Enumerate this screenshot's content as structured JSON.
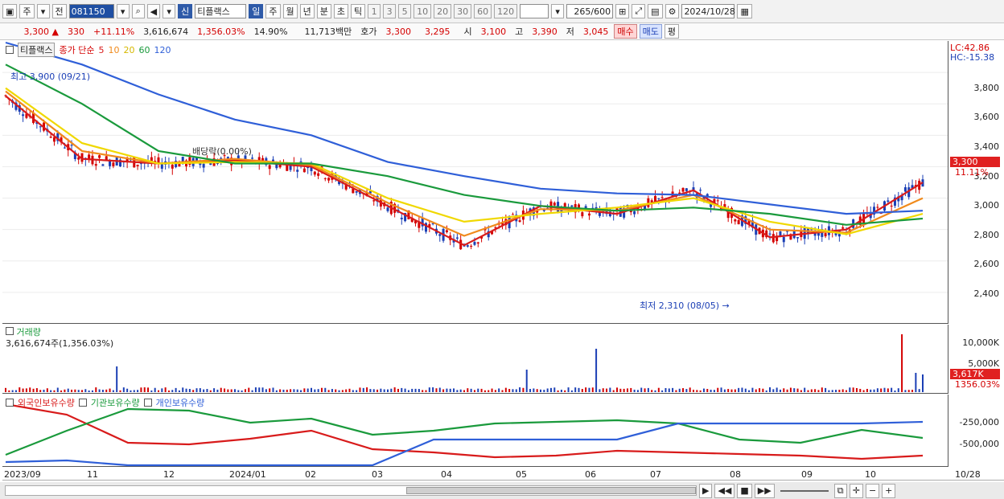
{
  "toolbar": {
    "period_mode": "주",
    "prev": "전",
    "stock_code": "081150",
    "new_badge": "신",
    "stock_name": "티플랙스",
    "periods": [
      "일",
      "주",
      "월",
      "년",
      "분",
      "초",
      "틱"
    ],
    "active_period": "일",
    "minute_options": [
      "1",
      "3",
      "5",
      "10",
      "20",
      "30",
      "60",
      "120"
    ],
    "count_value": "265",
    "count_max": "/600",
    "date": "2024/10/28"
  },
  "quote": {
    "price": "3,300",
    "change_arrow": "▲",
    "change": "330",
    "change_pct": "+11.11%",
    "volume": "3,616,674",
    "volume_ratio": "1,356.03%",
    "turnover": "14.90%",
    "amount": "11,713백만",
    "ask_label": "호가",
    "ask": "3,300",
    "bid": "3,295",
    "open_label": "시",
    "open": "3,100",
    "high_label": "고",
    "high": "3,390",
    "low_label": "저",
    "low": "3,045",
    "buy_label": "매수",
    "sell_label": "매도",
    "flat_label": "평"
  },
  "price_pane": {
    "name": "티플랙스",
    "indicator": "종가 단순",
    "ma_periods": [
      "5",
      "10",
      "20",
      "60",
      "120"
    ],
    "lc": "LC:42.86",
    "hc": "HC:-15.38",
    "high_note": "최고 3,900 (09/21)",
    "low_note": "최저 2,310 (08/05)",
    "dividend_note": "배당락(0.00%)",
    "last_price": "3,300",
    "last_pct": "11.11%",
    "yticks": [
      "3,800",
      "3,600",
      "3,400",
      "3,200",
      "3,000",
      "2,800",
      "2,600",
      "2,400"
    ]
  },
  "volume_pane": {
    "title": "거래량",
    "value": "3,616,674주(1,356.03%)",
    "yticks": [
      "10,000K",
      "5,000K"
    ],
    "last": "3,617K",
    "last_pct": "1356.03%"
  },
  "holding_pane": {
    "series": [
      "외국인보유수량",
      "기관보유수량",
      "개인보유수량"
    ],
    "yticks": [
      "-250,000",
      "-500,000"
    ]
  },
  "xaxis": [
    "2023/09",
    "11",
    "12",
    "2024/01",
    "02",
    "03",
    "04",
    "05",
    "06",
    "07",
    "08",
    "09",
    "10",
    "10/28"
  ],
  "colors": {
    "ma5": "#d81b1b",
    "ma10": "#f08a1c",
    "ma20": "#f0d800",
    "ma60": "#1a9a3c",
    "ma120": "#2f5fd8",
    "up": "#d40000",
    "down": "#1b3fb5",
    "foreign": "#d81b1b",
    "inst": "#1a9a3c",
    "retail": "#2f5fd8"
  },
  "chart_data": {
    "type": "line",
    "title": "티플랙스",
    "x": [
      "2023/09",
      "11",
      "12",
      "2024/01",
      "02",
      "03",
      "04",
      "05",
      "06",
      "07",
      "08",
      "09",
      "10"
    ],
    "series": [
      {
        "name": "5",
        "values": [
          3650,
          3250,
          3220,
          3240,
          3200,
          2950,
          2700,
          2950,
          2900,
          3050,
          2750,
          2800,
          3100
        ]
      },
      {
        "name": "10",
        "values": [
          3680,
          3300,
          3220,
          3250,
          3210,
          2970,
          2760,
          2930,
          2920,
          3020,
          2800,
          2780,
          3000
        ]
      },
      {
        "name": "20",
        "values": [
          3700,
          3350,
          3220,
          3230,
          3220,
          3000,
          2850,
          2900,
          2940,
          3000,
          2850,
          2770,
          2900
        ]
      },
      {
        "name": "60",
        "values": [
          3850,
          3600,
          3300,
          3220,
          3220,
          3140,
          3020,
          2950,
          2920,
          2940,
          2900,
          2830,
          2870
        ]
      },
      {
        "name": "120",
        "values": [
          3990,
          3850,
          3660,
          3500,
          3400,
          3230,
          3140,
          3060,
          3030,
          3020,
          2960,
          2900,
          2920
        ]
      }
    ],
    "ylim": [
      2200,
      4000
    ],
    "annotations": [
      "최고 3,900 (09/21)",
      "최저 2,310 (08/05)"
    ]
  }
}
